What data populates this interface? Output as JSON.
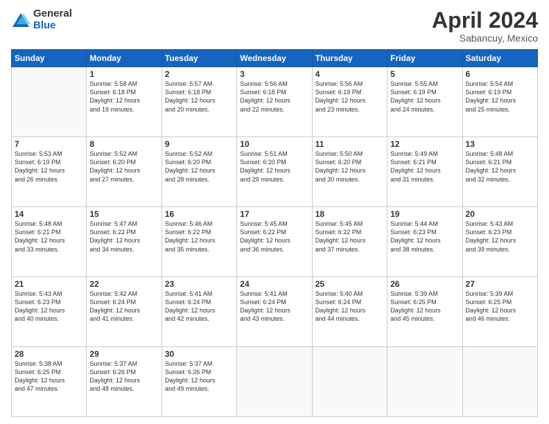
{
  "logo": {
    "general": "General",
    "blue": "Blue"
  },
  "title": "April 2024",
  "subtitle": "Sabancuy, Mexico",
  "days_header": [
    "Sunday",
    "Monday",
    "Tuesday",
    "Wednesday",
    "Thursday",
    "Friday",
    "Saturday"
  ],
  "weeks": [
    [
      {
        "day": "",
        "info": ""
      },
      {
        "day": "1",
        "info": "Sunrise: 5:58 AM\nSunset: 6:18 PM\nDaylight: 12 hours\nand 19 minutes."
      },
      {
        "day": "2",
        "info": "Sunrise: 5:57 AM\nSunset: 6:18 PM\nDaylight: 12 hours\nand 20 minutes."
      },
      {
        "day": "3",
        "info": "Sunrise: 5:56 AM\nSunset: 6:18 PM\nDaylight: 12 hours\nand 22 minutes."
      },
      {
        "day": "4",
        "info": "Sunrise: 5:56 AM\nSunset: 6:19 PM\nDaylight: 12 hours\nand 23 minutes."
      },
      {
        "day": "5",
        "info": "Sunrise: 5:55 AM\nSunset: 6:19 PM\nDaylight: 12 hours\nand 24 minutes."
      },
      {
        "day": "6",
        "info": "Sunrise: 5:54 AM\nSunset: 6:19 PM\nDaylight: 12 hours\nand 25 minutes."
      }
    ],
    [
      {
        "day": "7",
        "info": "Sunrise: 5:53 AM\nSunset: 6:19 PM\nDaylight: 12 hours\nand 26 minutes."
      },
      {
        "day": "8",
        "info": "Sunrise: 5:52 AM\nSunset: 6:20 PM\nDaylight: 12 hours\nand 27 minutes."
      },
      {
        "day": "9",
        "info": "Sunrise: 5:52 AM\nSunset: 6:20 PM\nDaylight: 12 hours\nand 28 minutes."
      },
      {
        "day": "10",
        "info": "Sunrise: 5:51 AM\nSunset: 6:20 PM\nDaylight: 12 hours\nand 29 minutes."
      },
      {
        "day": "11",
        "info": "Sunrise: 5:50 AM\nSunset: 6:20 PM\nDaylight: 12 hours\nand 30 minutes."
      },
      {
        "day": "12",
        "info": "Sunrise: 5:49 AM\nSunset: 6:21 PM\nDaylight: 12 hours\nand 31 minutes."
      },
      {
        "day": "13",
        "info": "Sunrise: 5:48 AM\nSunset: 6:21 PM\nDaylight: 12 hours\nand 32 minutes."
      }
    ],
    [
      {
        "day": "14",
        "info": "Sunrise: 5:48 AM\nSunset: 6:21 PM\nDaylight: 12 hours\nand 33 minutes."
      },
      {
        "day": "15",
        "info": "Sunrise: 5:47 AM\nSunset: 6:22 PM\nDaylight: 12 hours\nand 34 minutes."
      },
      {
        "day": "16",
        "info": "Sunrise: 5:46 AM\nSunset: 6:22 PM\nDaylight: 12 hours\nand 35 minutes."
      },
      {
        "day": "17",
        "info": "Sunrise: 5:45 AM\nSunset: 6:22 PM\nDaylight: 12 hours\nand 36 minutes."
      },
      {
        "day": "18",
        "info": "Sunrise: 5:45 AM\nSunset: 6:22 PM\nDaylight: 12 hours\nand 37 minutes."
      },
      {
        "day": "19",
        "info": "Sunrise: 5:44 AM\nSunset: 6:23 PM\nDaylight: 12 hours\nand 38 minutes."
      },
      {
        "day": "20",
        "info": "Sunrise: 5:43 AM\nSunset: 6:23 PM\nDaylight: 12 hours\nand 39 minutes."
      }
    ],
    [
      {
        "day": "21",
        "info": "Sunrise: 5:43 AM\nSunset: 6:23 PM\nDaylight: 12 hours\nand 40 minutes."
      },
      {
        "day": "22",
        "info": "Sunrise: 5:42 AM\nSunset: 6:24 PM\nDaylight: 12 hours\nand 41 minutes."
      },
      {
        "day": "23",
        "info": "Sunrise: 5:41 AM\nSunset: 6:24 PM\nDaylight: 12 hours\nand 42 minutes."
      },
      {
        "day": "24",
        "info": "Sunrise: 5:41 AM\nSunset: 6:24 PM\nDaylight: 12 hours\nand 43 minutes."
      },
      {
        "day": "25",
        "info": "Sunrise: 5:40 AM\nSunset: 6:24 PM\nDaylight: 12 hours\nand 44 minutes."
      },
      {
        "day": "26",
        "info": "Sunrise: 5:39 AM\nSunset: 6:25 PM\nDaylight: 12 hours\nand 45 minutes."
      },
      {
        "day": "27",
        "info": "Sunrise: 5:39 AM\nSunset: 6:25 PM\nDaylight: 12 hours\nand 46 minutes."
      }
    ],
    [
      {
        "day": "28",
        "info": "Sunrise: 5:38 AM\nSunset: 6:25 PM\nDaylight: 12 hours\nand 47 minutes."
      },
      {
        "day": "29",
        "info": "Sunrise: 5:37 AM\nSunset: 6:26 PM\nDaylight: 12 hours\nand 48 minutes."
      },
      {
        "day": "30",
        "info": "Sunrise: 5:37 AM\nSunset: 6:26 PM\nDaylight: 12 hours\nand 49 minutes."
      },
      {
        "day": "",
        "info": ""
      },
      {
        "day": "",
        "info": ""
      },
      {
        "day": "",
        "info": ""
      },
      {
        "day": "",
        "info": ""
      }
    ]
  ]
}
